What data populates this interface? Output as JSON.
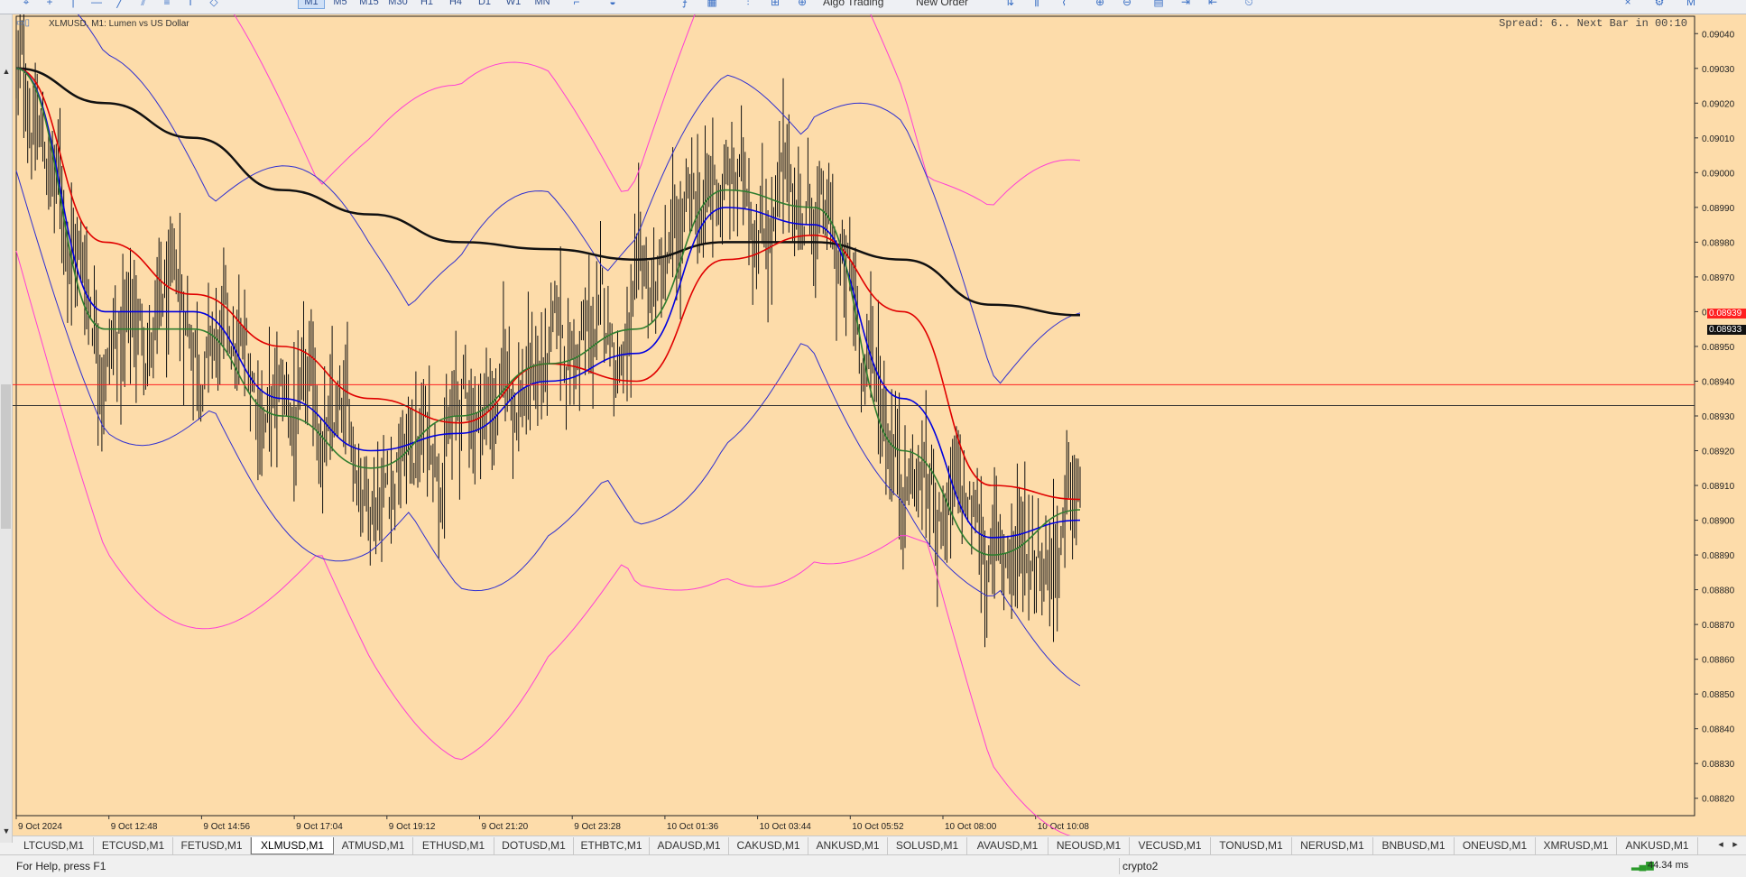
{
  "toolbar": {
    "timeframes": [
      "M1",
      "M5",
      "M15",
      "M30",
      "H1",
      "H4",
      "D1",
      "W1",
      "MN"
    ],
    "active_timeframe": "M1",
    "algo_trading_label": "Algo Trading",
    "new_order_label": "New Order"
  },
  "chart": {
    "title": "XLMUSD, M1:  Lumen vs US Dollar",
    "spread_info": "Spread: 6.. Next Bar in 00:10",
    "background_color": "#fddcaa",
    "bid_line_color": "#ff2020",
    "bid_price": "0.08939",
    "last_price": "0.08933",
    "price_axis": [
      "0.09040",
      "0.09030",
      "0.09020",
      "0.09010",
      "0.09000",
      "0.08990",
      "0.08980",
      "0.08970",
      "0.08960",
      "0.08950",
      "0.08940",
      "0.08930",
      "0.08920",
      "0.08910",
      "0.08900",
      "0.08890",
      "0.08880",
      "0.08870",
      "0.08860",
      "0.08850",
      "0.08840",
      "0.08830",
      "0.08820"
    ],
    "time_axis": [
      "9 Oct 2024",
      "9 Oct 12:48",
      "9 Oct 14:56",
      "9 Oct 17:04",
      "9 Oct 19:12",
      "9 Oct 21:20",
      "9 Oct 23:28",
      "10 Oct 01:36",
      "10 Oct 03:44",
      "10 Oct 05:52",
      "10 Oct 08:00",
      "10 Oct 10:08"
    ]
  },
  "chart_data": {
    "type": "line",
    "ylim": [
      0.08815,
      0.09045
    ],
    "x": [
      "9 Oct 2024",
      "9 Oct 12:48",
      "9 Oct 14:56",
      "9 Oct 17:04",
      "9 Oct 19:12",
      "9 Oct 21:20",
      "9 Oct 23:28",
      "10 Oct 01:36",
      "10 Oct 03:44",
      "10 Oct 05:52",
      "10 Oct 08:00",
      "10 Oct 10:08",
      "10 Oct 10:40"
    ],
    "series": [
      {
        "color": "#111111",
        "values": [
          0.0903,
          0.0902,
          0.0901,
          0.08995,
          0.08988,
          0.0898,
          0.08978,
          0.08975,
          0.0898,
          0.0898,
          0.08975,
          0.08962,
          0.08959
        ]
      },
      {
        "color": "#e00000",
        "values": [
          0.0903,
          0.0898,
          0.08965,
          0.0895,
          0.08935,
          0.08928,
          0.08945,
          0.0894,
          0.08975,
          0.08982,
          0.0896,
          0.0891,
          0.08906
        ]
      },
      {
        "color": "#0000e0",
        "values": [
          0.0903,
          0.0896,
          0.0896,
          0.08935,
          0.0892,
          0.08925,
          0.0894,
          0.08948,
          0.0899,
          0.08985,
          0.08935,
          0.08895,
          0.089
        ]
      },
      {
        "color": "#2f7d2f",
        "values": [
          0.0903,
          0.08955,
          0.08955,
          0.0893,
          0.08915,
          0.0893,
          0.08945,
          0.08955,
          0.08995,
          0.0899,
          0.0892,
          0.0889,
          0.08903
        ]
      }
    ]
  },
  "tabs": [
    "LTCUSD,M1",
    "ETCUSD,M1",
    "FETUSD,M1",
    "XLMUSD,M1",
    "ATMUSD,M1",
    "ETHUSD,M1",
    "DOTUSD,M1",
    "ETHBTC,M1",
    "ADAUSD,M1",
    "CAKUSD,M1",
    "ANKUSD,M1",
    "SOLUSD,M1",
    "AVAUSD,M1",
    "NEOUSD,M1",
    "VECUSD,M1",
    "TONUSD,M1",
    "NERUSD,M1",
    "BNBUSD,M1",
    "ONEUSD,M1",
    "XMRUSD,M1",
    "ANKUSD,M1"
  ],
  "active_tab": "XLMUSD,M1",
  "status": {
    "help": "For Help, press F1",
    "profile": "crypto2",
    "ping": "44.34 ms"
  }
}
